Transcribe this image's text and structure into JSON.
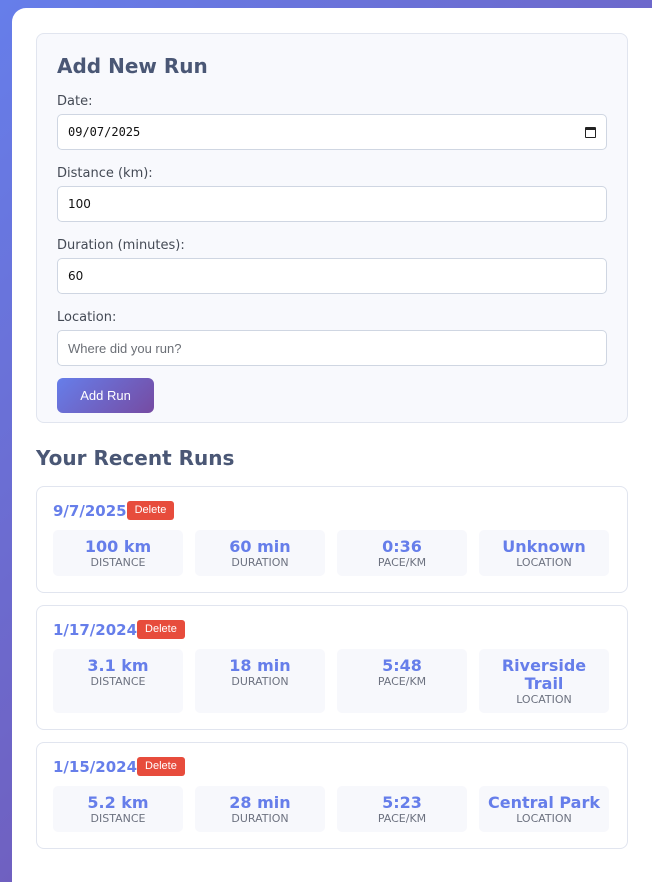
{
  "form": {
    "title": "Add New Run",
    "date_label": "Date:",
    "date_value": "09/07/2025",
    "distance_label": "Distance (km):",
    "distance_value": "100",
    "duration_label": "Duration (minutes):",
    "duration_value": "60",
    "location_label": "Location:",
    "location_placeholder": "Where did you run?",
    "submit_label": "Add Run"
  },
  "recent": {
    "title": "Your Recent Runs",
    "delete_label": "Delete",
    "stat_labels": {
      "distance": "DISTANCE",
      "duration": "DURATION",
      "pace": "PACE/KM",
      "location": "LOCATION"
    },
    "runs": [
      {
        "date": "9/7/2025",
        "distance": "100 km",
        "duration": "60 min",
        "pace": "0:36",
        "location": "Unknown"
      },
      {
        "date": "1/17/2024",
        "distance": "3.1 km",
        "duration": "18 min",
        "pace": "5:48",
        "location": "Riverside Trail"
      },
      {
        "date": "1/15/2024",
        "distance": "5.2 km",
        "duration": "28 min",
        "pace": "5:23",
        "location": "Central Park"
      }
    ]
  },
  "colors": {
    "accent": "#667eea",
    "accent_end": "#764ba2",
    "delete": "#e74c3c",
    "heading": "#4a5775"
  }
}
